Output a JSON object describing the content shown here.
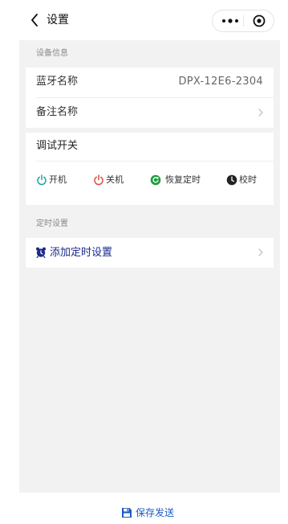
{
  "nav": {
    "title": "设置",
    "back_icon": "chevron-left-icon",
    "more_icon": "more-dots-icon",
    "close_icon": "target-circle-icon"
  },
  "device_info": {
    "section_label": "设备信息",
    "bluetooth_label": "蓝牙名称",
    "bluetooth_value": "DPX-12E6-2304",
    "remark_label": "备注名称"
  },
  "debug": {
    "title": "调试开关",
    "controls": [
      {
        "label": "开机",
        "icon": "power-on-icon",
        "color": "#1aa3a3"
      },
      {
        "label": "关机",
        "icon": "power-off-icon",
        "color": "#e0493f"
      },
      {
        "label": "恢复定时",
        "icon": "restore-timer-icon",
        "color": "#1e9e3e"
      },
      {
        "label": "校时",
        "icon": "calibrate-time-icon",
        "color": "#222222"
      }
    ]
  },
  "timer": {
    "section_label": "定时设置",
    "add_label": "添加定时设置",
    "add_icon": "alarm-clock-icon"
  },
  "footer": {
    "save_label": "保存发送",
    "save_icon": "floppy-disk-icon",
    "accent": "#1c5bc4"
  }
}
